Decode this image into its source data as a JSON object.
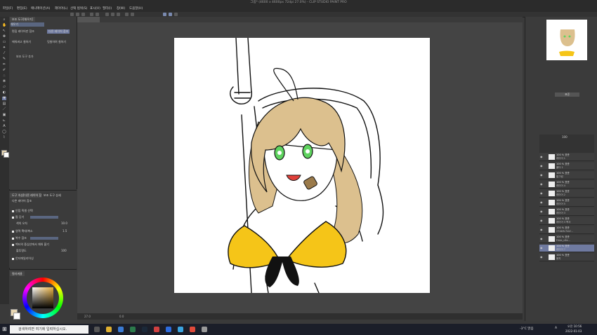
{
  "app": {
    "title": "그림* (4600 x 4600px 72dpi 27.0%) - CLIP STUDIO PAINT PRO"
  },
  "menu": [
    "파일(F)",
    "편집(E)",
    "애니메이션(A)",
    "레이어(L)",
    "선택 범위(S)",
    "표시(V)",
    "필터(I)",
    "창(W)",
    "도움말(H)"
  ],
  "subtool": {
    "tabs": [
      "보조 도구[채우기]",
      "서브 도구"
    ],
    "items": [
      "채우기",
      "편집 레이어만 참조",
      "다른 레이어 참조",
      "에워싸고 칠하기",
      "덧칠하여 칠하기"
    ],
    "add_label": "보조 도구 추가"
  },
  "tool_property": {
    "tabs": [
      "도구 속성[다른 레이어 참조]",
      "보조 도구 상세"
    ],
    "title": "다른 레이어 참조",
    "rows": [
      {
        "label": "인접 픽셀 선택",
        "value": ""
      },
      {
        "label": "틈 닫기",
        "value": ""
      },
      {
        "label": "색의 오차",
        "value": "10.0"
      },
      {
        "label": "영역 확대/축소",
        "value": "1.5"
      },
      {
        "label": "복수 참조",
        "value": ""
      },
      {
        "label": "벡터의 중심선에서 채워 붙기",
        "value": ""
      },
      {
        "label": "불투명도",
        "value": "100"
      },
      {
        "label": "안티에일리어싱",
        "value": ""
      }
    ]
  },
  "color_panel": {
    "tab": "컬러써클",
    "main_color": "#e8d7b3",
    "sub_color": "#ffffff"
  },
  "layers": {
    "blend_label": "표준",
    "opacity": "100",
    "items": [
      {
        "name": "100 % 표준",
        "sub": "레이어 1"
      },
      {
        "name": "100 % 표준",
        "sub": "폴더 1"
      },
      {
        "name": "100 % 표준",
        "sub": "밑그림"
      },
      {
        "name": "100 % 표준",
        "sub": "레이어 4"
      },
      {
        "name": "100 % 표준",
        "sub": "레이어 2"
      },
      {
        "name": "100 % 표준",
        "sub": "레이어 5"
      },
      {
        "name": "100 % 표준",
        "sub": "레이어 3"
      },
      {
        "name": "100 % 표준",
        "sub": "레이어 3 복사"
      },
      {
        "name": "100 % 표준",
        "sub": "27db9c7dcf..."
      },
      {
        "name": "100 % 표준",
        "sub": "Frida_c8e..."
      },
      {
        "name": "100 % 표준",
        "sub": "레이어 7"
      },
      {
        "name": "100 % 표준",
        "sub": "용지"
      }
    ],
    "selected_index": 10
  },
  "status": {
    "zoom": "27.0",
    "angle": "0.0"
  },
  "taskbar": {
    "search_placeholder": "검색하려면 여기에 입력하십시오.",
    "weather": "-3°C 맑음",
    "time": "오전 10:56",
    "date": "2022-01-03",
    "lang": "A"
  },
  "colors": {
    "hair": "#dcc08e",
    "bikini": "#f5c518",
    "eyes": "#5fd35f",
    "tongue": "#e0403a",
    "ribbon": "#111111"
  }
}
